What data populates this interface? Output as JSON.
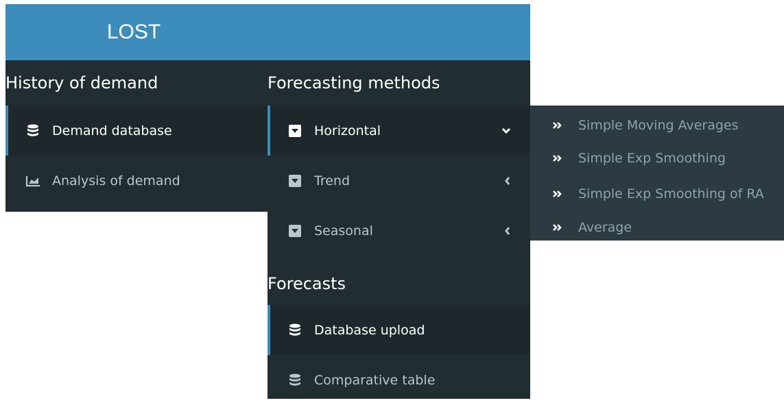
{
  "header": {
    "title": "LOST"
  },
  "history": {
    "title": "History of demand",
    "items": [
      {
        "label": "Demand database",
        "icon": "database-icon",
        "active": true
      },
      {
        "label": "Analysis of demand",
        "icon": "area-chart-icon",
        "active": false
      }
    ]
  },
  "methods": {
    "title": "Forecasting methods",
    "items": [
      {
        "label": "Horizontal",
        "icon": "caret-square-down-icon",
        "chevron": "chevron-down-icon",
        "expanded": true
      },
      {
        "label": "Trend",
        "icon": "caret-square-down-icon",
        "chevron": "chevron-left-icon",
        "expanded": false
      },
      {
        "label": "Seasonal",
        "icon": "caret-square-down-icon",
        "chevron": "chevron-left-icon",
        "expanded": false
      }
    ],
    "submenu": [
      {
        "label": "Simple Moving Averages",
        "icon": "angle-double-right-icon"
      },
      {
        "label": "Simple Exp Smoothing",
        "icon": "angle-double-right-icon"
      },
      {
        "label": "Simple Exp Smoothing of RA",
        "icon": "angle-double-right-icon"
      },
      {
        "label": "Average",
        "icon": "angle-double-right-icon"
      }
    ]
  },
  "forecasts": {
    "title": "Forecasts",
    "items": [
      {
        "label": "Database upload",
        "icon": "database-icon",
        "active": true
      },
      {
        "label": "Comparative table",
        "icon": "database-icon",
        "active": false
      }
    ]
  },
  "colors": {
    "header_bg": "#3c8dbc",
    "sidebar_bg": "#222d32",
    "active_bg": "#1e282c",
    "submenu_bg": "#2c3b41",
    "accent": "#3c8dbc",
    "text_muted": "#b8c7ce",
    "submenu_text": "#8aa4af"
  }
}
